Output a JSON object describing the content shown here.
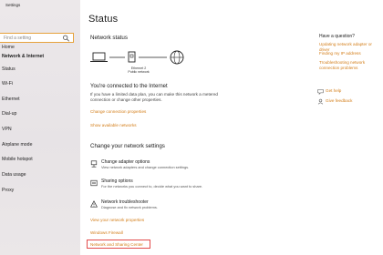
{
  "window": {
    "title": "Settings"
  },
  "nav": {
    "search_placeholder": "Find a setting",
    "items": [
      {
        "label": "Home",
        "bold": false
      },
      {
        "label": "Network & Internet",
        "bold": true
      },
      {
        "label": "Status",
        "bold": false
      },
      {
        "label": "Wi-Fi",
        "bold": false
      },
      {
        "label": "Ethernet",
        "bold": false
      },
      {
        "label": "Dial-up",
        "bold": false
      },
      {
        "label": "VPN",
        "bold": false
      },
      {
        "label": "Airplane mode",
        "bold": false
      },
      {
        "label": "Mobile hotspot",
        "bold": false
      },
      {
        "label": "Data usage",
        "bold": false
      },
      {
        "label": "Proxy",
        "bold": false
      }
    ]
  },
  "main": {
    "title": "Status",
    "network_status_heading": "Network status",
    "adapter_name": "Ethernet 2",
    "adapter_network": "Public network",
    "connected_title": "You're connected to the Internet",
    "connected_desc": "If you have a limited data plan, you can make this network a metered connection or change other properties.",
    "change_connection_properties": "Change connection properties",
    "show_available_networks": "Show available networks",
    "change_settings_heading": "Change your network settings",
    "options": [
      {
        "title": "Change adapter options",
        "desc": "View network adapters and change connection settings."
      },
      {
        "title": "Sharing options",
        "desc": "For the networks you connect to, decide what you want to share."
      },
      {
        "title": "Network troubleshooter",
        "desc": "Diagnose and fix network problems."
      }
    ],
    "view_network_properties": "View your network properties",
    "windows_firewall": "Windows Firewall",
    "network_sharing_center": "Network and Sharing Center"
  },
  "help": {
    "heading": "Have a question?",
    "links": [
      "Updating network adapter or driver",
      "Finding my IP address",
      "Troubleshooting network connection problems"
    ],
    "get_help": "Get help",
    "give_feedback": "Give feedback"
  },
  "colors": {
    "accent": "#d37d18",
    "highlight_border": "#e24b4b",
    "nav_bg": "#ece8ea"
  }
}
